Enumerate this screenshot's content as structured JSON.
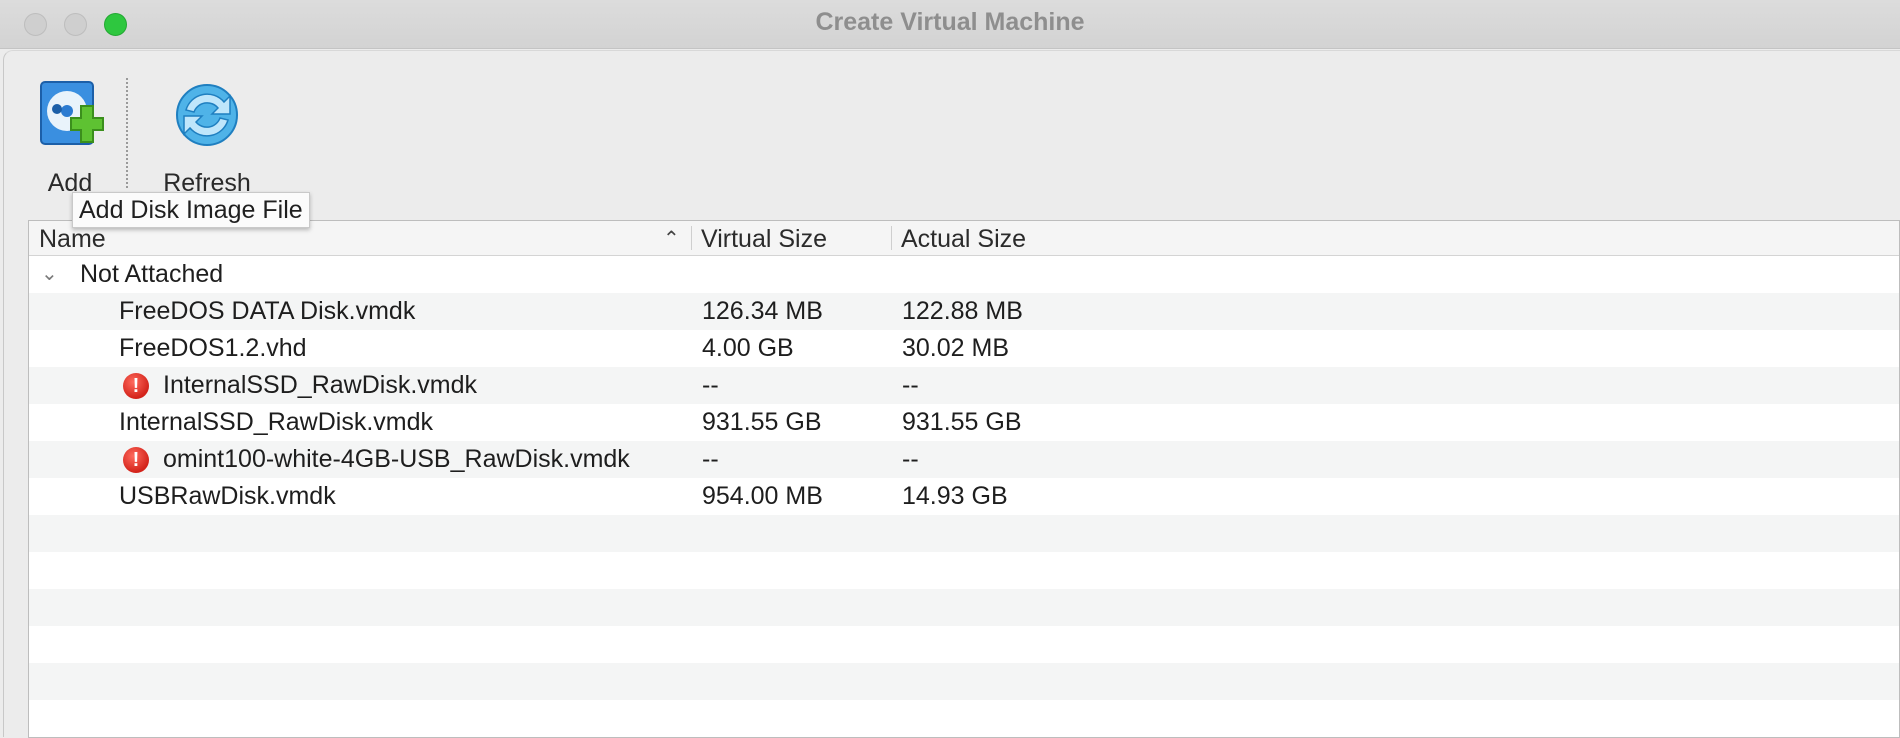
{
  "window": {
    "title": "Create Virtual Machine"
  },
  "toolbar": {
    "add_label": "Add",
    "refresh_label": "Refresh",
    "tooltip": "Add Disk Image File"
  },
  "table": {
    "columns": {
      "name": "Name",
      "virtual_size": "Virtual Size",
      "actual_size": "Actual Size"
    },
    "group": {
      "label": "Not Attached",
      "expanded": true
    },
    "rows": [
      {
        "name": "FreeDOS DATA Disk.vmdk",
        "virtual_size": "126.34 MB",
        "actual_size": "122.88 MB",
        "error": false
      },
      {
        "name": "FreeDOS1.2.vhd",
        "virtual_size": "4.00 GB",
        "actual_size": "30.02 MB",
        "error": false
      },
      {
        "name": "InternalSSD_RawDisk.vmdk",
        "virtual_size": "--",
        "actual_size": "--",
        "error": true
      },
      {
        "name": "InternalSSD_RawDisk.vmdk",
        "virtual_size": "931.55 GB",
        "actual_size": "931.55 GB",
        "error": false
      },
      {
        "name": "omint100-white-4GB-USB_RawDisk.vmdk",
        "virtual_size": "--",
        "actual_size": "--",
        "error": true
      },
      {
        "name": "USBRawDisk.vmdk",
        "virtual_size": "954.00 MB",
        "actual_size": "14.93 GB",
        "error": false
      }
    ]
  },
  "icons": {
    "add": "disk-add-icon",
    "refresh": "refresh-icon",
    "error": "error-icon",
    "sort": "sort-ascending-icon",
    "group_toggle": "chevron-down-icon"
  },
  "colors": {
    "zoom_button": "#2ec73f",
    "error_red": "#d3231a",
    "row_alt": "#f4f5f5"
  }
}
